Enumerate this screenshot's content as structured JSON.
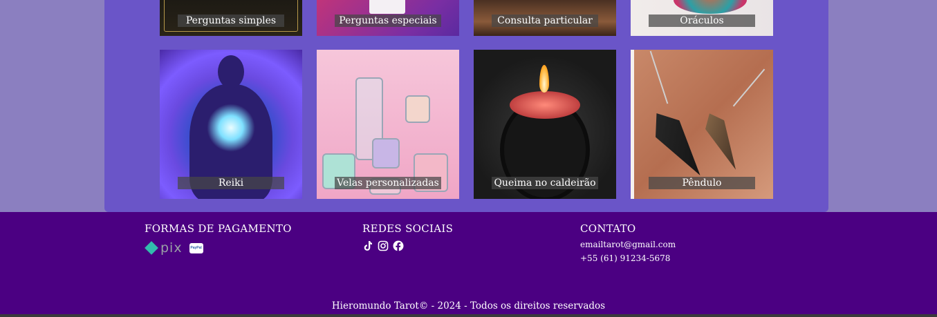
{
  "services_row1": [
    {
      "label": "Perguntas simples",
      "icon": "tarot-card-image"
    },
    {
      "label": "Perguntas especiais",
      "icon": "card-image"
    },
    {
      "label": "Consulta particular",
      "icon": "table-image"
    },
    {
      "label": "Oráculos",
      "icon": "mandala-image"
    }
  ],
  "services_row2": [
    {
      "label": "Reiki",
      "icon": "meditation-image"
    },
    {
      "label": "Velas personalizadas",
      "icon": "candles-image"
    },
    {
      "label": "Queima no caldeirão",
      "icon": "cauldron-image"
    },
    {
      "label": "Pêndulo",
      "icon": "pendulum-image"
    }
  ],
  "footer": {
    "payment_title": "FORMAS DE PAGAMENTO",
    "pix_text": "pix",
    "paypal_text": "PayPal",
    "social_title": "REDES SOCIAIS",
    "contact_title": "CONTATO",
    "email": "emailtarot@gmail.com",
    "phone": "+55 (61) 91234-5678",
    "copyright": "Hieromundo Tarot© - 2024 - Todos os direitos reservados"
  },
  "colors": {
    "page_bg": "#8b7fc0",
    "panel_bg": "#6a55c8",
    "footer_bg": "#4b0082",
    "label_bg": "#464646"
  }
}
